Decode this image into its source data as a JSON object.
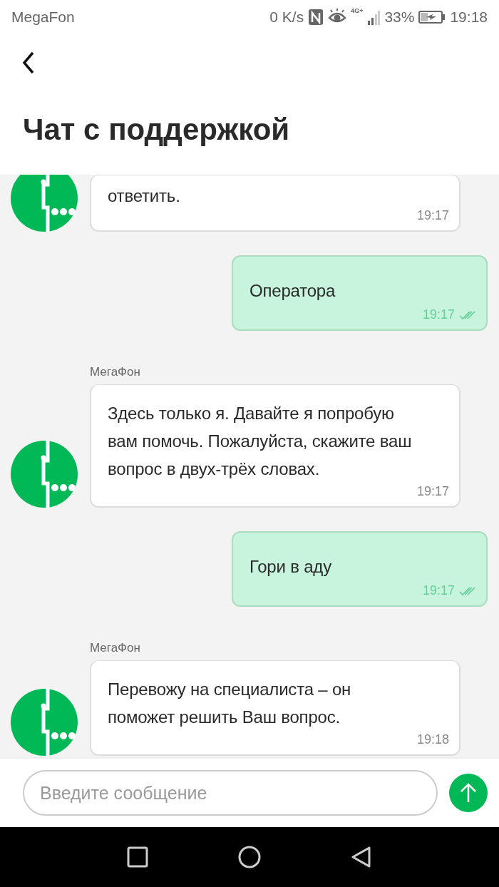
{
  "status_bar": {
    "carrier": "MegaFon",
    "speed": "0 K/s",
    "network": "4G+",
    "battery": "33%",
    "time": "19:18"
  },
  "header": {
    "title": "Чат с поддержкой"
  },
  "messages": [
    {
      "kind": "incoming",
      "text": "ответить.",
      "time": "19:17"
    },
    {
      "kind": "outgoing",
      "text": "Оператора",
      "time": "19:17",
      "read": true
    },
    {
      "kind": "incoming",
      "sender": "МегаФон",
      "text": "Здесь только я. Давайте я попробую вам помочь. Пожалуйста, скажите ваш вопрос в двух-трёх словах.",
      "time": "19:17"
    },
    {
      "kind": "outgoing",
      "text": "Гори в аду",
      "time": "19:17",
      "read": true
    },
    {
      "kind": "incoming",
      "sender": "МегаФон",
      "text": "Перевожу на специалиста – он поможет решить Ваш вопрос.",
      "time": "19:18"
    }
  ],
  "composer": {
    "placeholder": "Введите сообщение"
  }
}
